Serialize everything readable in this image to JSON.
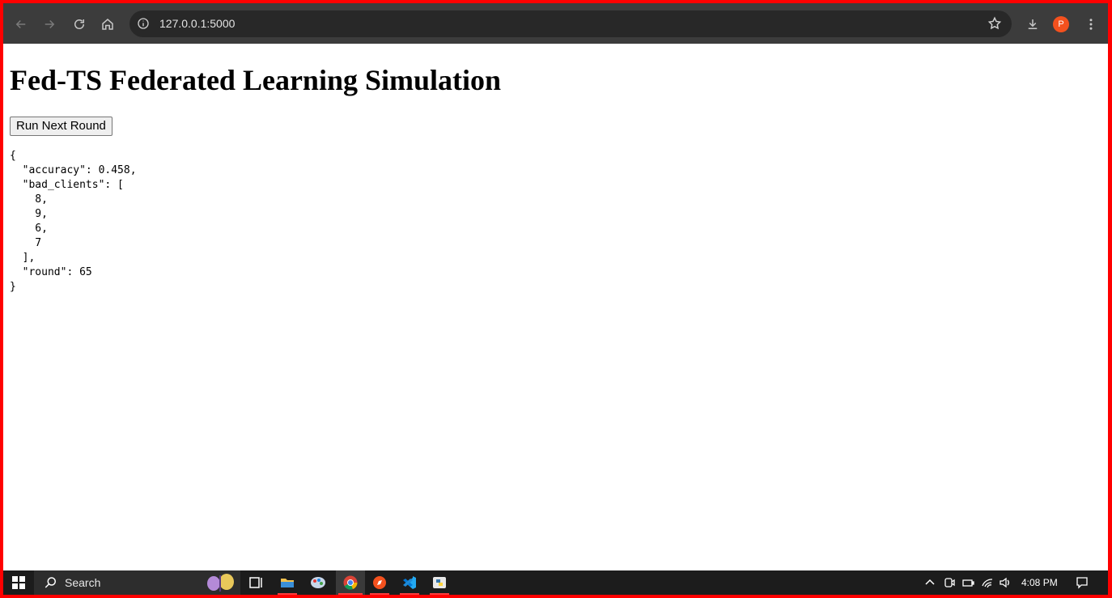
{
  "browser": {
    "url": "127.0.0.1:5000",
    "profile_initial": "P"
  },
  "page": {
    "title": "Fed-TS Federated Learning Simulation",
    "run_button_label": "Run Next Round",
    "output_json": "{\n  \"accuracy\": 0.458,\n  \"bad_clients\": [\n    8,\n    9,\n    6,\n    7\n  ],\n  \"round\": 65\n}"
  },
  "taskbar": {
    "search_label": "Search",
    "clock": "4:08 PM"
  },
  "colors": {
    "frame": "#ff0000",
    "toolbar": "#3c3c3c",
    "omnibox": "#282828",
    "taskbar": "#1c1c1c",
    "avatar": "#f4511e"
  }
}
